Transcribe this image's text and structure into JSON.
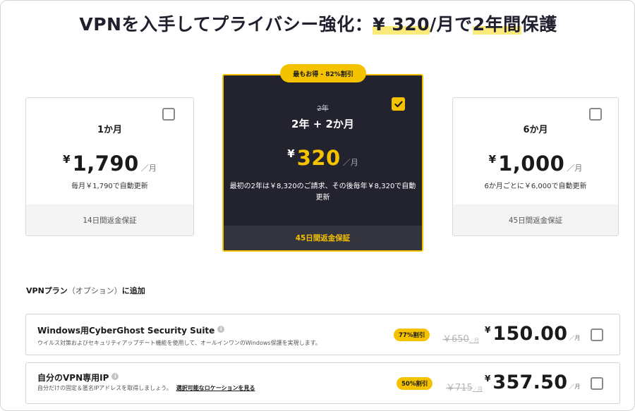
{
  "headline": {
    "prefix": "VPNを入手してプライバシー強化：",
    "price_highlight": "¥ 320",
    "middle": "/月で",
    "term_highlight": "2年間",
    "suffix": "保護"
  },
  "plans": [
    {
      "name": "1か月",
      "currency": "¥",
      "amount": "1,790",
      "per": "／月",
      "renewal": "毎月￥1,790で自動更新",
      "guarantee": "14日間返金保証",
      "selected": false
    },
    {
      "badge": "最もお得 - 82%割引",
      "old_term": "2年",
      "name": "2年 + 2か月",
      "currency": "¥",
      "amount": "320",
      "per": "／月",
      "renewal": "最初の2年は￥8,320のご請求、その後毎年￥8,320で自動更新",
      "guarantee": "45日間返金保証",
      "selected": true
    },
    {
      "name": "6か月",
      "currency": "¥",
      "amount": "1,000",
      "per": "／月",
      "renewal": "6か月ごとに￥6,000で自動更新",
      "guarantee": "45日間返金保証",
      "selected": false
    }
  ],
  "addons": {
    "title": "VPNプラン",
    "title_optional": "（オプション）",
    "title_suffix": "に追加",
    "items": [
      {
        "title": "Windows用CyberGhost Security Suite",
        "description": "ウイルス対策およびセキュリティアップデート機能を使用して、オールインワンのWindows保護を実現します。",
        "discount": "77%割引",
        "old_price": "￥650",
        "old_unit": "／月",
        "currency": "¥",
        "price": "150.00",
        "unit": "／月",
        "selected": false
      },
      {
        "title": "自分のVPN専用IP",
        "description": "自分だけの固定＆匿名IPアドレスを取得しましょう。",
        "link": "選択可能なロケーションを見る",
        "discount": "50%割引",
        "old_price": "￥715",
        "old_unit": "／月",
        "currency": "¥",
        "price": "357.50",
        "unit": "／月",
        "selected": false
      }
    ]
  },
  "icons": {
    "info": "info-icon",
    "check": "check-icon"
  },
  "colors": {
    "accent": "#f5c200",
    "featured_bg": "#23232f",
    "highlight": "#fbe97a"
  }
}
